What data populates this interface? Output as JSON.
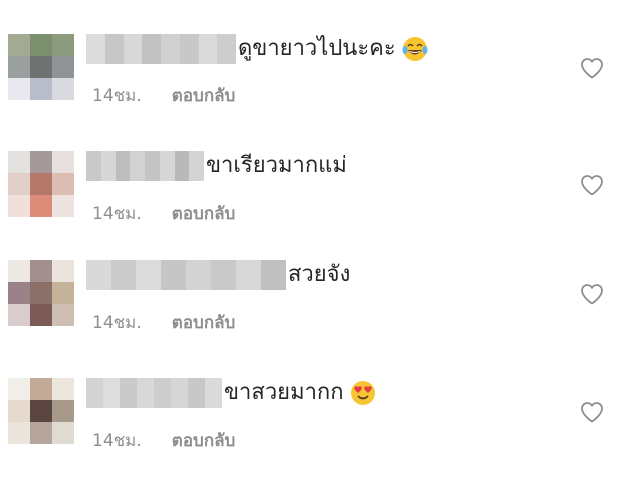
{
  "comments": [
    {
      "text": "ดูขายาวไปนะคะ",
      "time": "14ชม.",
      "reply": "ตอบกลับ",
      "emoji": "face-with-tears-of-joy",
      "avatar_colors": [
        "#a2aa94",
        "#7c8f6c",
        "#8c9a7e",
        "#9aa0a0",
        "#6e7372",
        "#8f9396",
        "#e8e8ee",
        "#b9bccb",
        "#d9dadf"
      ],
      "username_colors": [
        "#dcdcdc",
        "#c7c7c7",
        "#d8d8d8",
        "#c2c2c2",
        "#d0d0d0",
        "#c8c8c8",
        "#dadada",
        "#cdcdcd"
      ]
    },
    {
      "text": "ขาเรียวมากแม่",
      "time": "14ชม.",
      "reply": "ตอบกลับ",
      "emoji": "",
      "avatar_colors": [
        "#e4e2e0",
        "#a59a99",
        "#e6e1df",
        "#e3cfc9",
        "#b7786c",
        "#dcbcb3",
        "#f1dfdb",
        "#de8c7a",
        "#ede3e1"
      ],
      "username_colors": [
        "#c9c9c9",
        "#d7d7d7",
        "#bdbdbd",
        "#d2d2d2",
        "#c4c4c4",
        "#d6d6d6",
        "#b9b9b9",
        "#d4d4d4"
      ]
    },
    {
      "text": "สวยจัง",
      "time": "14ชม.",
      "reply": "ตอบกลับ",
      "emoji": "",
      "avatar_colors": [
        "#ece8e4",
        "#a28f8e",
        "#ebe4dc",
        "#9a8288",
        "#8a7069",
        "#c5b29b",
        "#d8cccc",
        "#7c5a56",
        "#cdbfb2"
      ],
      "username_colors": [
        "#d9d9d9",
        "#cbcbcb",
        "#dcdcdc",
        "#c6c6c6",
        "#d3d3d3",
        "#c9c9c9",
        "#d8d8d8",
        "#c0c0c0"
      ]
    },
    {
      "text": "ขาสวยมากก",
      "time": "14ชม.",
      "reply": "ตอบกลับ",
      "emoji": "smiling-face-with-heart-eyes",
      "avatar_colors": [
        "#f1eee9",
        "#c2aa96",
        "#ece6dd",
        "#e6d9cd",
        "#5b4540",
        "#a79a8b",
        "#ebe5de",
        "#b5a59d",
        "#e0dbd3"
      ],
      "username_colors": [
        "#d3d3d3",
        "#dddddd",
        "#cacaca",
        "#d8d8d8",
        "#cdcdcd",
        "#d6d6d6",
        "#c8c8c8",
        "#dadada"
      ]
    }
  ],
  "icons": {
    "like": "heart-outline-icon"
  },
  "colors": {
    "text": "#262626",
    "meta": "#8e8e8e",
    "heart": "#8e8e8e"
  }
}
